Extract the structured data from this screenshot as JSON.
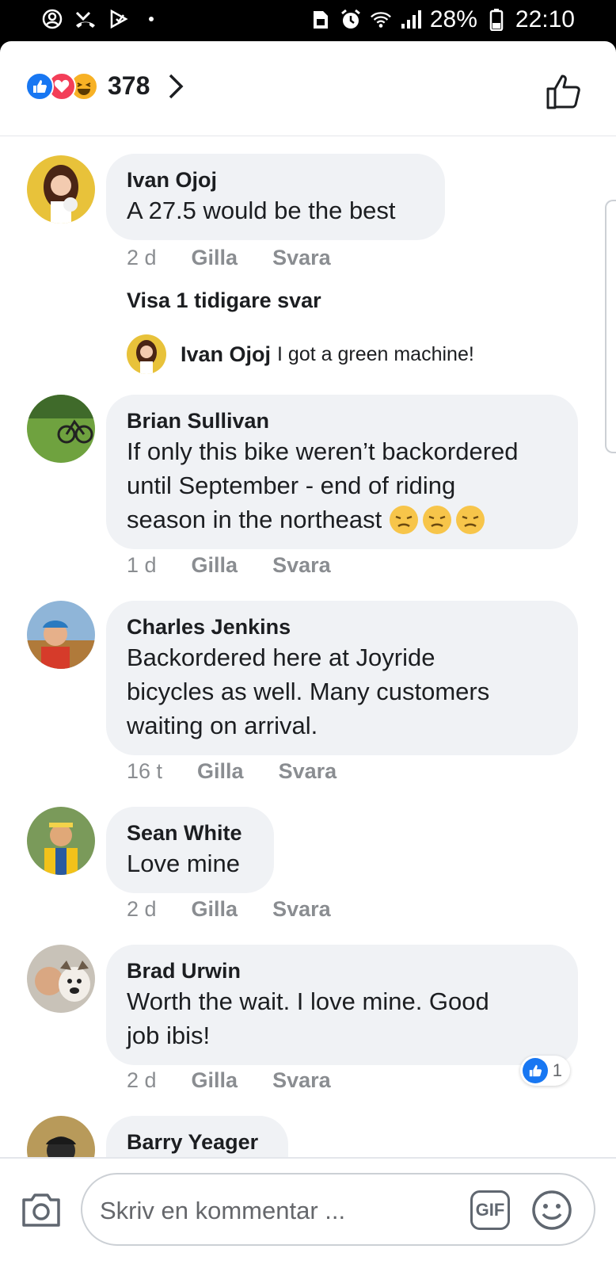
{
  "status_bar": {
    "battery": "28%",
    "time": "22:10"
  },
  "reactions": {
    "count": "378",
    "types": [
      "like-icon",
      "love-icon",
      "haha-icon"
    ]
  },
  "comments": [
    {
      "author": "Ivan Ojoj",
      "text": "A 27.5 would be the best",
      "time": "2 d",
      "like_label": "Gilla",
      "reply_label": "Svara",
      "earlier_replies": "Visa 1 tidigare svar",
      "reply": {
        "author": "Ivan Ojoj",
        "text": "I got a green machine!"
      }
    },
    {
      "author": "Brian Sullivan",
      "text_lines": [
        "If only this bike weren’t backordered",
        "until September - end of riding",
        "season in the northeast"
      ],
      "time": "1 d",
      "like_label": "Gilla",
      "reply_label": "Svara"
    },
    {
      "author": "Charles Jenkins",
      "text_lines": [
        "Backordered here at Joyride",
        "bicycles as well. Many customers",
        "waiting on arrival."
      ],
      "time": "16 t",
      "like_label": "Gilla",
      "reply_label": "Svara"
    },
    {
      "author": "Sean White",
      "text": "Love mine",
      "time": "2 d",
      "like_label": "Gilla",
      "reply_label": "Svara"
    },
    {
      "author": "Brad Urwin",
      "text_lines": [
        "Worth the wait. I love mine. Good",
        "job ibis!"
      ],
      "time": "2 d",
      "like_label": "Gilla",
      "reply_label": "Svara",
      "likes": "1"
    },
    {
      "author": "Barry Yeager"
    }
  ],
  "composer": {
    "placeholder": "Skriv en kommentar ...",
    "gif_label": "GIF"
  },
  "colors": {
    "facebook_blue": "#1877f2",
    "love_red": "#f33e58",
    "haha_yellow": "#f7b125",
    "bubble_bg": "#f0f2f5"
  }
}
